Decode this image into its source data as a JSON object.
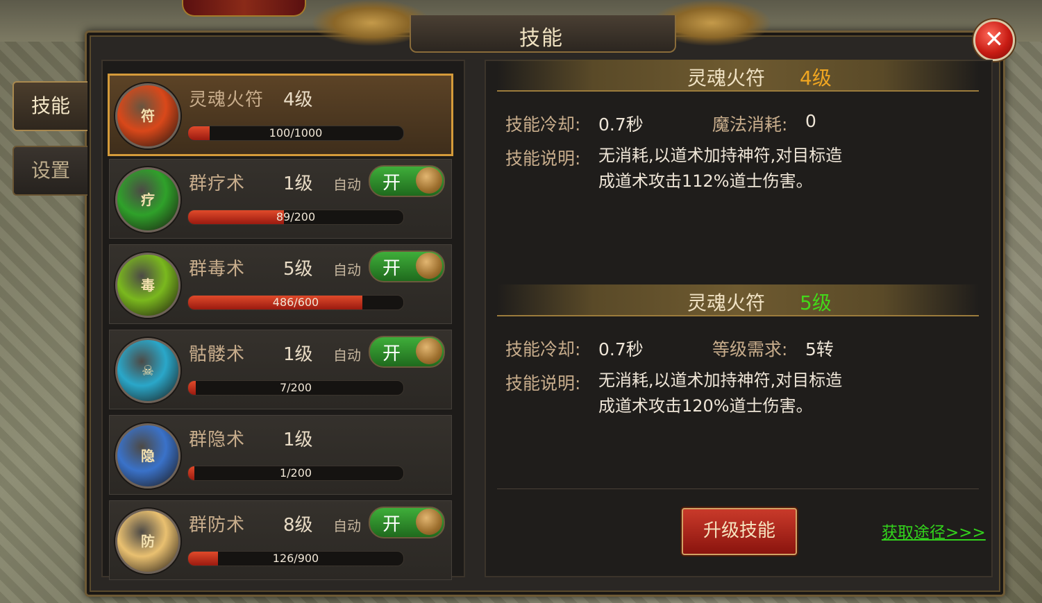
{
  "title": "技能",
  "close_symbol": "✕",
  "sidebar": {
    "tabs": [
      {
        "label": "技能",
        "active": true
      },
      {
        "label": "设置",
        "active": false
      }
    ]
  },
  "skills": [
    {
      "name": "灵魂火符",
      "level": "4级",
      "auto_label": "",
      "toggle": "",
      "progress_text": "100/1000",
      "progress": 0.1,
      "icon": "fire-talisman-icon",
      "icon_glyph": "符",
      "icon_color": "#d9481a"
    },
    {
      "name": "群疗术",
      "level": "1级",
      "auto_label": "自动",
      "toggle": "开",
      "progress_text": "89/200",
      "progress": 0.445,
      "icon": "green-heal-icon",
      "icon_glyph": "疗",
      "icon_color": "#2fa12a"
    },
    {
      "name": "群毒术",
      "level": "5级",
      "auto_label": "自动",
      "toggle": "开",
      "progress_text": "486/600",
      "progress": 0.81,
      "icon": "poison-icon",
      "icon_glyph": "毒",
      "icon_color": "#7ab81e"
    },
    {
      "name": "骷髅术",
      "level": "1级",
      "auto_label": "自动",
      "toggle": "开",
      "progress_text": "7/200",
      "progress": 0.035,
      "icon": "skull-icon",
      "icon_glyph": "☠",
      "icon_color": "#2aa7c9"
    },
    {
      "name": "群隐术",
      "level": "1级",
      "auto_label": "",
      "toggle": "",
      "progress_text": "1/200",
      "progress": 0.005,
      "icon": "stealth-figures-icon",
      "icon_glyph": "隐",
      "icon_color": "#3a72c9"
    },
    {
      "name": "群防术",
      "level": "8级",
      "auto_label": "自动",
      "toggle": "开",
      "progress_text": "126/900",
      "progress": 0.14,
      "icon": "defense-talisman-icon",
      "icon_glyph": "防",
      "icon_color": "#e9c070"
    }
  ],
  "current": {
    "name": "灵魂火符",
    "level": "4级",
    "level_color": "#f0a621",
    "cooldown_label": "技能冷却:",
    "cooldown_value": "0.7秒",
    "extra_label": "魔法消耗:",
    "extra_value": "0",
    "desc_label": "技能说明:",
    "desc_line1": "无消耗,以道术加持神符,对目标造",
    "desc_line2": "成道术攻击112%道士伤害。"
  },
  "next": {
    "name": "灵魂火符",
    "level": "5级",
    "level_color": "#43d81a",
    "cooldown_label": "技能冷却:",
    "cooldown_value": "0.7秒",
    "extra_label": "等级需求:",
    "extra_value": "5转",
    "desc_label": "技能说明:",
    "desc_line1": "无消耗,以道术加持神符,对目标造",
    "desc_line2": "成道术攻击120%道士伤害。"
  },
  "actions": {
    "upgrade_label": "升级技能",
    "source_link": "获取途径>>>"
  }
}
